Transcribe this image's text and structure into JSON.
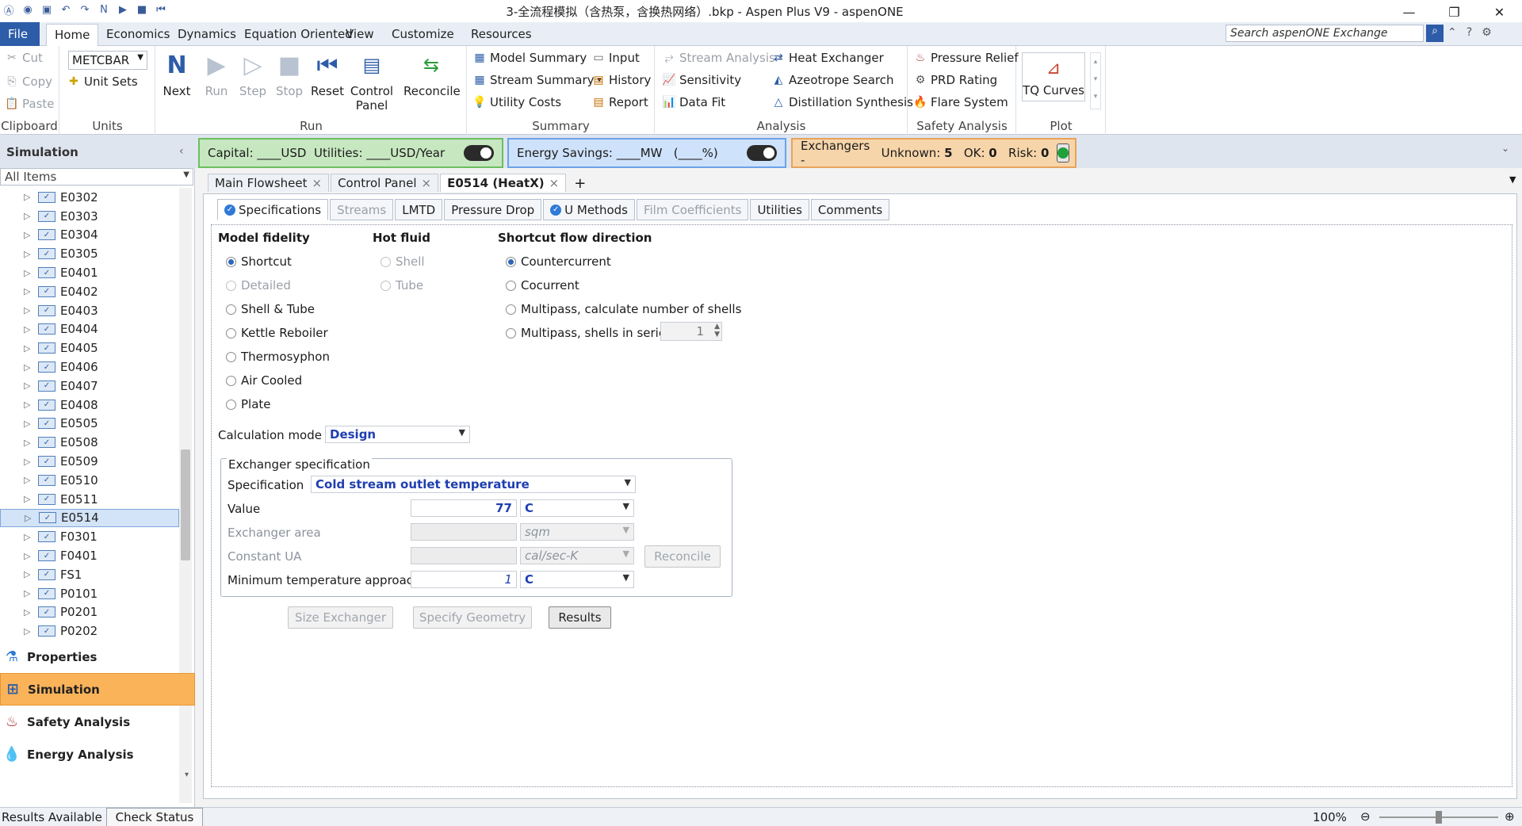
{
  "window": {
    "title": "3-全流程模拟（含热泵，含换热网络）.bkp - Aspen Plus V9 - aspenONE",
    "minimize": "—",
    "restore": "❐",
    "close": "✕"
  },
  "ribbon_tabs": [
    "File",
    "Home",
    "Economics",
    "Dynamics",
    "Equation Oriented",
    "View",
    "Customize",
    "Resources"
  ],
  "search": {
    "placeholder": "Search aspenONE Exchange"
  },
  "clipboard": {
    "cut": "Cut",
    "copy": "Copy",
    "paste": "Paste",
    "label": "Clipboard"
  },
  "units": {
    "value": "METCBAR",
    "unit_sets": "Unit Sets",
    "label": "Units"
  },
  "run": {
    "next": "Next",
    "run": "Run",
    "step": "Step",
    "stop": "Stop",
    "reset": "Reset",
    "control_panel": "Control Panel",
    "reconcile": "Reconcile",
    "label": "Run"
  },
  "summary": {
    "model_summary": "Model Summary",
    "stream_summary": "Stream Summary",
    "utility_costs": "Utility Costs",
    "input": "Input",
    "history": "History",
    "report": "Report",
    "label": "Summary"
  },
  "analysis": {
    "stream_analysis": "Stream Analysis",
    "sensitivity": "Sensitivity",
    "data_fit": "Data Fit",
    "heat_exchanger": "Heat Exchanger",
    "azeotrope_search": "Azeotrope Search",
    "distillation_synthesis": "Distillation Synthesis",
    "label": "Analysis"
  },
  "safety": {
    "pressure_relief": "Pressure Relief",
    "prd_rating": "PRD Rating",
    "flare_system": "Flare System",
    "label": "Safety Analysis"
  },
  "plot": {
    "tq_curves": "TQ Curves",
    "label": "Plot"
  },
  "nav": {
    "title": "Simulation",
    "filter": "All Items",
    "tree": [
      "E0302",
      "E0303",
      "E0304",
      "E0305",
      "E0401",
      "E0402",
      "E0403",
      "E0404",
      "E0405",
      "E0406",
      "E0407",
      "E0408",
      "E0505",
      "E0508",
      "E0509",
      "E0510",
      "E0511",
      "E0514",
      "F0301",
      "F0401",
      "FS1",
      "P0101",
      "P0201",
      "P0202"
    ],
    "selected": "E0514",
    "buttons": [
      "Properties",
      "Simulation",
      "Safety Analysis",
      "Energy Analysis"
    ]
  },
  "econ_panel": {
    "capital": "Capital: ____USD",
    "utilities": "Utilities: ____USD/Year"
  },
  "energy_panel": {
    "savings": "Energy Savings: ____MW",
    "percent": "(____%)"
  },
  "exch_panel": {
    "label": "Exchangers -",
    "unknown_label": "Unknown:",
    "unknown": "5",
    "ok_label": "OK:",
    "ok": "0",
    "risk_label": "Risk:",
    "risk": "0"
  },
  "doc_tabs": [
    "Main Flowsheet",
    "Control Panel",
    "E0514 (HeatX)"
  ],
  "form_tabs": [
    "Specifications",
    "Streams",
    "LMTD",
    "Pressure Drop",
    "U Methods",
    "Film Coefficients",
    "Utilities",
    "Comments"
  ],
  "form": {
    "model_fidelity": "Model fidelity",
    "fidelity_options": [
      "Shortcut",
      "Detailed",
      "Shell & Tube",
      "Kettle Reboiler",
      "Thermosyphon",
      "Air Cooled",
      "Plate"
    ],
    "hot_fluid": "Hot fluid",
    "hot_options": [
      "Shell",
      "Tube"
    ],
    "flow_direction": "Shortcut flow direction",
    "flow_options": [
      "Countercurrent",
      "Cocurrent",
      "Multipass, calculate number of shells",
      "Multipass, shells in series"
    ],
    "shells": "1",
    "calc_mode_label": "Calculation mode",
    "calc_mode": "Design",
    "exch_spec": "Exchanger specification",
    "spec_label": "Specification",
    "spec_value": "Cold stream outlet temperature",
    "value_label": "Value",
    "value": "77",
    "value_unit": "C",
    "area_label": "Exchanger area",
    "area_unit": "sqm",
    "ua_label": "Constant UA",
    "ua_unit": "cal/sec-K",
    "reconcile": "Reconcile",
    "min_temp_label": "Minimum temperature approach",
    "min_temp": "1",
    "min_temp_unit": "C",
    "size_exchanger": "Size Exchanger",
    "specify_geometry": "Specify Geometry",
    "results": "Results"
  },
  "status": {
    "results": "Results Available",
    "check": "Check Status",
    "zoom": "100%"
  }
}
